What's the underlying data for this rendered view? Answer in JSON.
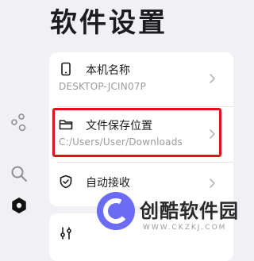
{
  "page": {
    "title": "软件设置"
  },
  "sidebar": {
    "items": [
      {
        "name": "share-icon"
      },
      {
        "name": "search-icon"
      },
      {
        "name": "settings-icon"
      }
    ]
  },
  "settings": {
    "device_name": {
      "label": "本机名称",
      "value": "DESKTOP-JCIN07P"
    },
    "save_location": {
      "label": "文件保存位置",
      "value": "C:/Users/User/Downloads"
    },
    "auto_receive": {
      "label": "自动接收"
    }
  },
  "watermark": {
    "title": "创酷软件园",
    "subtitle": "WWW.CKZKJ.COM"
  },
  "colors": {
    "accent": "#e0111b",
    "background": "#f1f1f5",
    "card": "#ffffff"
  }
}
